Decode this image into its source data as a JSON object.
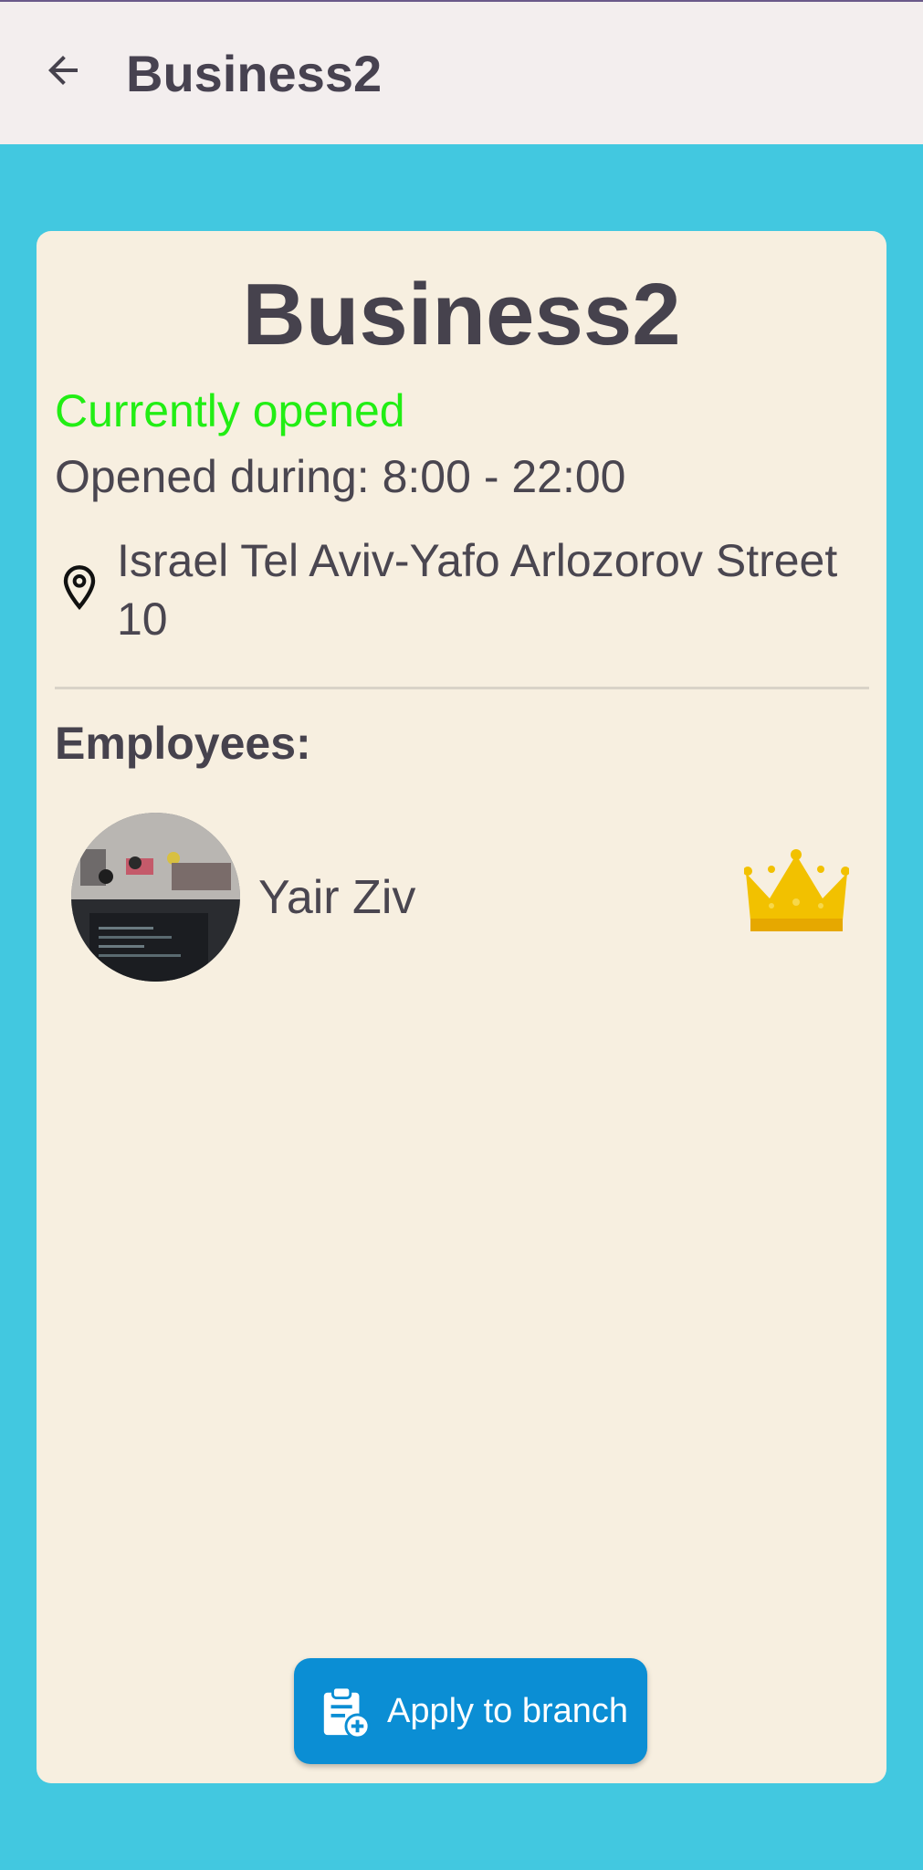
{
  "app_bar": {
    "title": "Business2"
  },
  "business": {
    "name": "Business2",
    "status": "Currently opened",
    "hours_label": "Opened during: ",
    "hours_open": "8:00",
    "hours_separator": " - ",
    "hours_close": "22:00",
    "address": "Israel Tel Aviv-Yafo Arlozorov Street 10"
  },
  "employees": {
    "heading": "Employees:",
    "list": [
      {
        "name": "Yair Ziv",
        "role_icon": "crown-icon"
      }
    ]
  },
  "actions": {
    "apply_label": "Apply to branch",
    "apply_icon": "clipboard-add-icon"
  },
  "colors": {
    "background": "#42c8e0",
    "app_bar": "#f3eeee",
    "card": "#f7efe0",
    "status_open": "#22ee14",
    "button": "#0b8ed4",
    "crown": "#f2c100"
  }
}
